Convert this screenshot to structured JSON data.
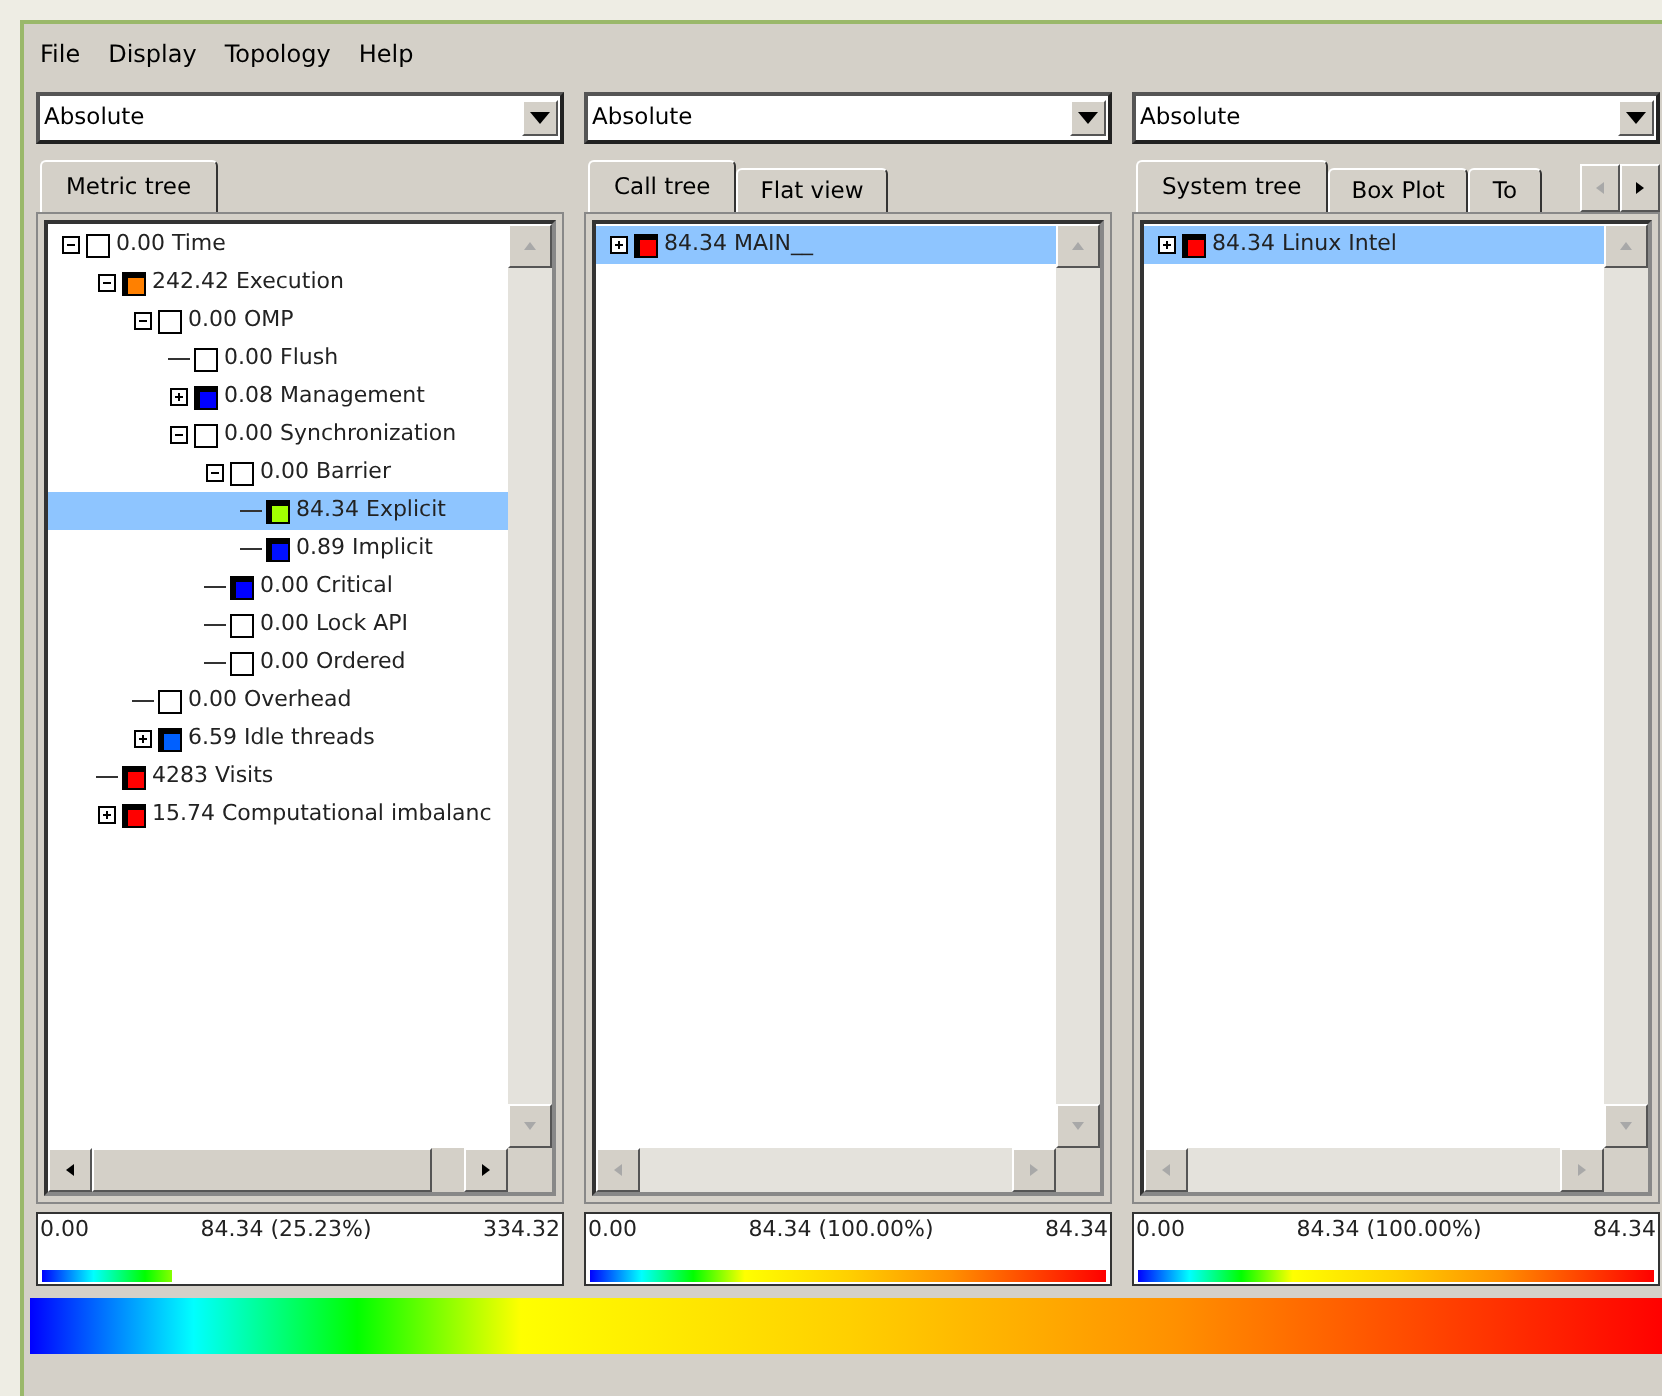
{
  "menu": [
    {
      "label": "File"
    },
    {
      "label": "Display"
    },
    {
      "label": "Topology"
    },
    {
      "label": "Help"
    }
  ],
  "panels": [
    {
      "mode": "Absolute",
      "tabs": [
        {
          "label": "Metric tree",
          "selected": true
        }
      ],
      "hscroll_enabled": true,
      "tree": [
        {
          "text": "0.00 Time",
          "color": "#ffffff",
          "expanded": true,
          "selected": false,
          "children": [
            {
              "text": "242.42 Execution",
              "color": "#ff8000",
              "expanded": true,
              "selected": false,
              "children": [
                {
                  "text": "0.00 OMP",
                  "color": "#ffffff",
                  "expanded": true,
                  "selected": false,
                  "children": [
                    {
                      "text": "0.00 Flush",
                      "color": "#ffffff",
                      "selected": false
                    },
                    {
                      "text": "0.08 Management",
                      "color": "#0000ff",
                      "expanded": false,
                      "selected": false
                    },
                    {
                      "text": "0.00 Synchronization",
                      "color": "#ffffff",
                      "expanded": true,
                      "selected": false,
                      "children": [
                        {
                          "text": "0.00 Barrier",
                          "color": "#ffffff",
                          "expanded": true,
                          "selected": false,
                          "children": [
                            {
                              "text": "84.34 Explicit",
                              "color": "#a0ff00",
                              "selected": true
                            },
                            {
                              "text": "0.89 Implicit",
                              "color": "#0010ff",
                              "selected": false
                            }
                          ]
                        },
                        {
                          "text": "0.00 Critical",
                          "color": "#0000ff",
                          "selected": false
                        },
                        {
                          "text": "0.00 Lock API",
                          "color": "#ffffff",
                          "selected": false
                        },
                        {
                          "text": "0.00 Ordered",
                          "color": "#ffffff",
                          "selected": false
                        }
                      ]
                    }
                  ]
                },
                {
                  "text": "0.00 Overhead",
                  "color": "#ffffff",
                  "selected": false
                },
                {
                  "text": "6.59 Idle threads",
                  "color": "#0060ff",
                  "expanded": false,
                  "selected": false
                }
              ]
            },
            {
              "text": "4283 Visits",
              "color": "#ff0000",
              "selected": false
            },
            {
              "text": "15.74 Computational imbalanc",
              "color": "#ff0000",
              "expanded": false,
              "selected": false
            }
          ]
        }
      ],
      "scale": {
        "min": "0.00",
        "center": "84.34 (25.23%)",
        "max": "334.32",
        "level": 0.2523
      }
    },
    {
      "mode": "Absolute",
      "tabs": [
        {
          "label": "Call tree",
          "selected": true
        },
        {
          "label": "Flat view",
          "selected": false
        }
      ],
      "hscroll_enabled": false,
      "tree": [
        {
          "text": "84.34 MAIN__",
          "color": "#ff0000",
          "expanded": false,
          "selected": true
        }
      ],
      "scale": {
        "min": "0.00",
        "center": "84.34 (100.00%)",
        "max": "84.34",
        "level": 1
      }
    },
    {
      "mode": "Absolute",
      "tabs": [
        {
          "label": "System tree",
          "selected": true
        },
        {
          "label": "Box Plot",
          "selected": false
        },
        {
          "label": "To",
          "selected": false
        }
      ],
      "tab_scroll": {
        "left_enabled": false,
        "right_enabled": true
      },
      "hscroll_enabled": false,
      "tree": [
        {
          "text": "84.34 Linux Intel",
          "color": "#ff0000",
          "expanded": false,
          "selected": true
        }
      ],
      "scale": {
        "min": "0.00",
        "center": "84.34 (100.00%)",
        "max": "84.34",
        "level": 1
      }
    }
  ]
}
